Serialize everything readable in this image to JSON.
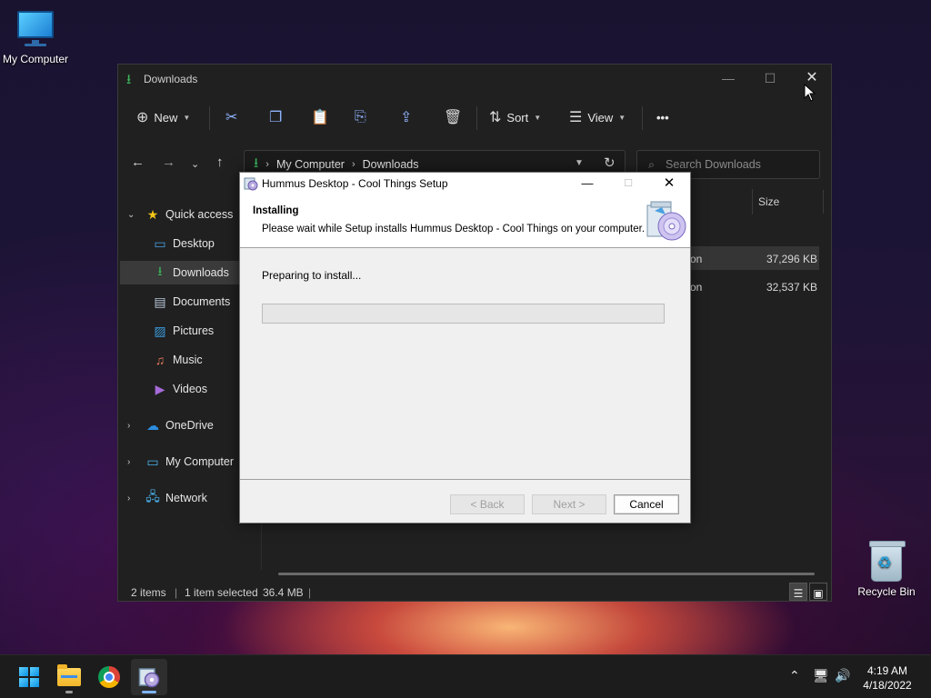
{
  "desktop": {
    "icons": [
      {
        "label": "My Computer"
      },
      {
        "label": "Recycle Bin"
      }
    ]
  },
  "explorer": {
    "title": "Downloads",
    "toolbar": {
      "new_label": "New",
      "sort_label": "Sort",
      "view_label": "View",
      "more_label": "•••"
    },
    "address": {
      "crumbs": [
        "My Computer",
        "Downloads"
      ]
    },
    "search": {
      "placeholder": "Search Downloads"
    },
    "nav": {
      "items": [
        {
          "label": "Quick access"
        },
        {
          "label": "Desktop"
        },
        {
          "label": "Downloads"
        },
        {
          "label": "Documents"
        },
        {
          "label": "Pictures"
        },
        {
          "label": "Music"
        },
        {
          "label": "Videos"
        },
        {
          "label": "OneDrive"
        },
        {
          "label": "My Computer"
        },
        {
          "label": "Network"
        }
      ]
    },
    "columns": {
      "size": "Size"
    },
    "files": [
      {
        "type": "on",
        "size": "37,296 KB",
        "selected": true
      },
      {
        "type": "on",
        "size": "32,537 KB",
        "selected": false
      }
    ],
    "status": {
      "items": "2 items",
      "selected": "1 item selected",
      "size": "36.4 MB",
      "sep": "|"
    }
  },
  "setup": {
    "title": "Hummus Desktop - Cool Things Setup",
    "header_title": "Installing",
    "header_subtitle": "Please wait while Setup installs Hummus Desktop - Cool Things on your computer.",
    "status_text": "Preparing to install...",
    "progress": 0,
    "buttons": {
      "back": "< Back",
      "next": "Next >",
      "cancel": "Cancel"
    },
    "colors": {
      "progress_fill": "#06b025"
    }
  },
  "taskbar": {
    "time": "4:19 AM",
    "date": "4/18/2022"
  }
}
